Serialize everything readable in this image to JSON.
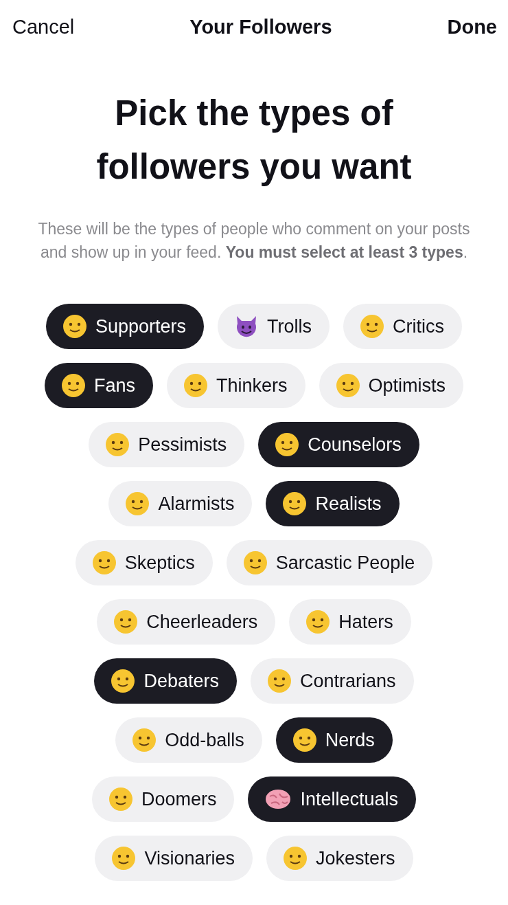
{
  "nav": {
    "cancel": "Cancel",
    "title": "Your Followers",
    "done": "Done"
  },
  "heading": "Pick the types of followers you want",
  "description": "These will be the types of people who comment on your posts and show up in your feed. **You must select at least 3 types**.",
  "rows": [
    [
      {
        "label": "Supporters",
        "kind": "face",
        "selected": true
      },
      {
        "label": "Trolls",
        "kind": "devil",
        "selected": false
      },
      {
        "label": "Critics",
        "kind": "face",
        "selected": false
      }
    ],
    [
      {
        "label": "Fans",
        "kind": "face",
        "selected": true
      },
      {
        "label": "Thinkers",
        "kind": "face",
        "selected": false
      },
      {
        "label": "Optimists",
        "kind": "face",
        "selected": false
      }
    ],
    [
      {
        "label": "Pessimists",
        "kind": "face",
        "selected": false
      },
      {
        "label": "Counselors",
        "kind": "face",
        "selected": true
      }
    ],
    [
      {
        "label": "Alarmists",
        "kind": "face",
        "selected": false
      },
      {
        "label": "Realists",
        "kind": "face",
        "selected": true
      }
    ],
    [
      {
        "label": "Skeptics",
        "kind": "face",
        "selected": false
      },
      {
        "label": "Sarcastic People",
        "kind": "face",
        "selected": false
      }
    ],
    [
      {
        "label": "Cheerleaders",
        "kind": "face",
        "selected": false
      },
      {
        "label": "Haters",
        "kind": "face",
        "selected": false
      }
    ],
    [
      {
        "label": "Debaters",
        "kind": "face",
        "selected": true
      },
      {
        "label": "Contrarians",
        "kind": "face",
        "selected": false
      }
    ],
    [
      {
        "label": "Odd-balls",
        "kind": "face",
        "selected": false
      },
      {
        "label": "Nerds",
        "kind": "face",
        "selected": true
      }
    ],
    [
      {
        "label": "Doomers",
        "kind": "face",
        "selected": false
      },
      {
        "label": "Intellectuals",
        "kind": "brain",
        "selected": true
      }
    ],
    [
      {
        "label": "Visionaries",
        "kind": "face",
        "selected": false
      },
      {
        "label": "Jokesters",
        "kind": "face",
        "selected": false
      }
    ]
  ]
}
